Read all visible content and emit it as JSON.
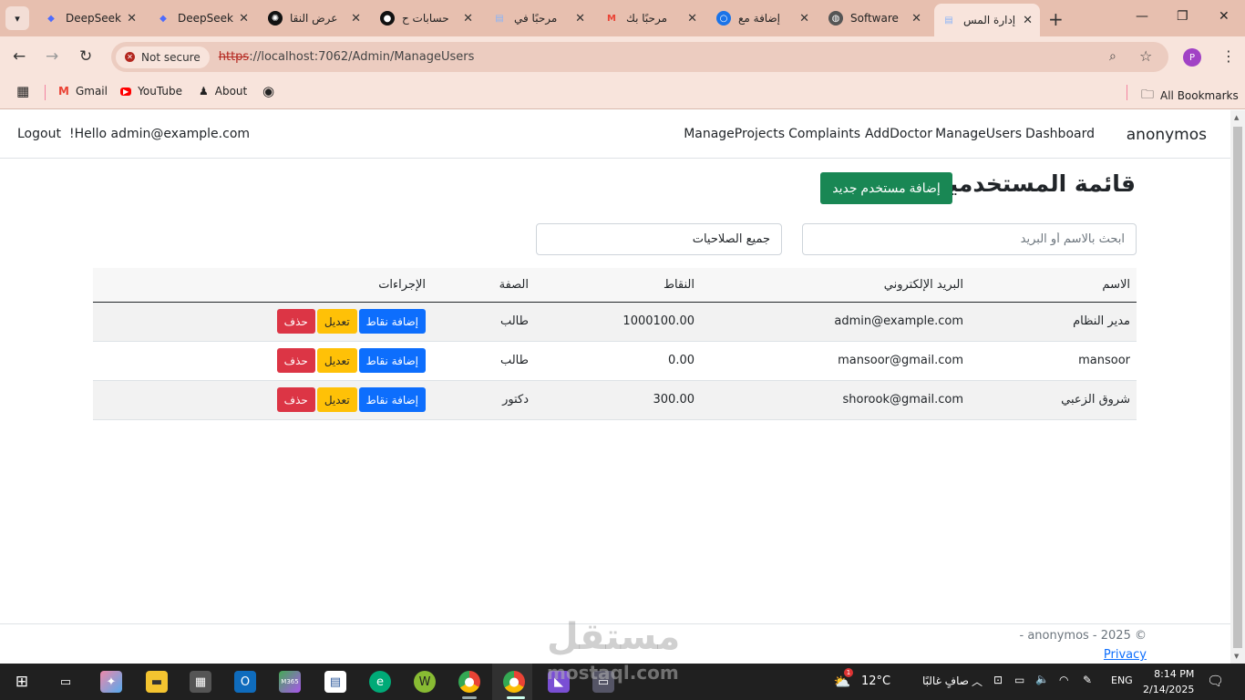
{
  "browser": {
    "tabs": [
      {
        "title": "DeepSeek",
        "icon": "deepseek-icon",
        "color": "#4d6bfe"
      },
      {
        "title": "DeepSeek",
        "icon": "deepseek-icon",
        "color": "#4d6bfe"
      },
      {
        "title": "عرض النقا",
        "icon": "chatgpt-icon",
        "color": "#111111"
      },
      {
        "title": "حسابات ح",
        "icon": "github-icon",
        "color": "#111111"
      },
      {
        "title": "مرحبًا في",
        "icon": "document-icon",
        "color": "#8ab4f8"
      },
      {
        "title": "مرحبًا بك",
        "icon": "gmail-icon",
        "color": "#ea4335"
      },
      {
        "title": "إضافة مع",
        "icon": "circle-icon",
        "color": "#1a73e8"
      },
      {
        "title": "Software",
        "icon": "globe-icon",
        "color": "#555555"
      },
      {
        "title": "إدارة المس",
        "icon": "document-icon",
        "color": "#8ab4f8"
      }
    ],
    "security_label": "Not secure",
    "url_scheme": "https",
    "url_rest": "://localhost:7062/Admin/ManageUsers",
    "profile_initial": "P",
    "bookmarks": [
      {
        "label": "Gmail",
        "icon": "gmail-icon"
      },
      {
        "label": "YouTube",
        "icon": "youtube-icon"
      },
      {
        "label": "About",
        "icon": "about-icon"
      },
      {
        "label": "",
        "icon": "github-icon"
      }
    ],
    "all_bookmarks": "All Bookmarks"
  },
  "navbar": {
    "brand": "anonymos",
    "links": [
      "Dashboard",
      "ManageUsers",
      "AddDoctor",
      "Complaints",
      "ManageProjects"
    ],
    "greeting": "!Hello admin@example.com",
    "logout": "Logout"
  },
  "main": {
    "title": "قائمة المستخدمين",
    "add_button": "إضافة مستخدم جديد",
    "search_placeholder": "ابحث بالاسم أو البريد",
    "role_filter": "جميع الصلاحيات",
    "table": {
      "headers": [
        "الاسم",
        "البريد الإلكتروني",
        "النقاط",
        "الصفة",
        "الإجراءات"
      ],
      "rows": [
        {
          "name": "مدير النظام",
          "email": "admin@example.com",
          "points": "1000100.00",
          "role": "طالب"
        },
        {
          "name": "mansoor",
          "email": "mansoor@gmail.com",
          "points": "0.00",
          "role": "طالب"
        },
        {
          "name": "شروق الزعبي",
          "email": "shorook@gmail.com",
          "points": "300.00",
          "role": "دكتور"
        }
      ],
      "actions": {
        "add_points": "إضافة نقاط",
        "edit": "تعديل",
        "delete": "حذف"
      }
    }
  },
  "footer": {
    "copyright": "© 2025 - anonymos -",
    "privacy": "Privacy"
  },
  "watermark": {
    "text": "مستقل",
    "sub": "mostaql.com"
  },
  "taskbar": {
    "weather_temp": "12°C",
    "weather_text": "صافٍ غالبًا",
    "weather_badge": "1",
    "language": "ENG",
    "time": "8:14 PM",
    "date": "2/14/2025"
  },
  "colors": {
    "primary": "#0d6efd",
    "success": "#198754",
    "warning": "#ffc107",
    "danger": "#dc3545",
    "chrome": "#e7bfaf"
  }
}
